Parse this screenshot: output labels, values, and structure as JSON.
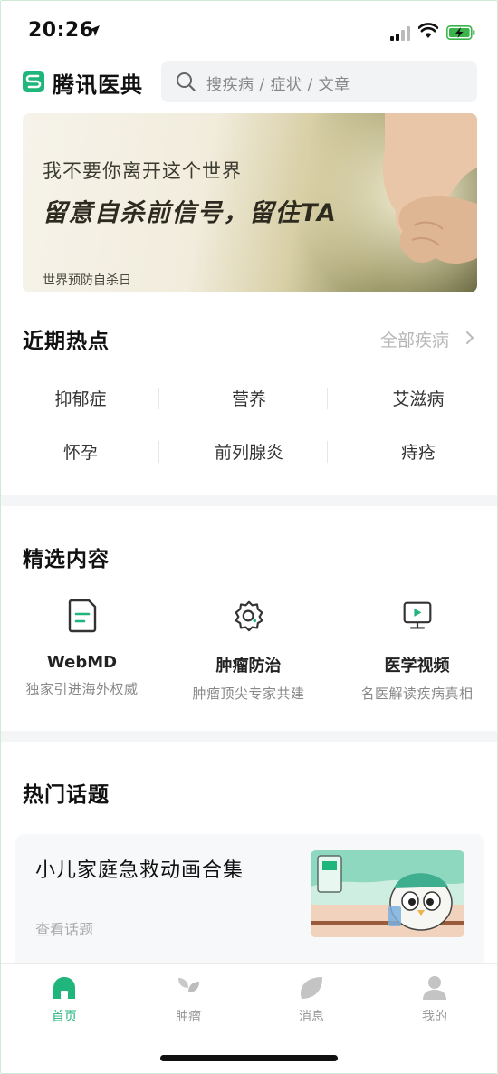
{
  "status_bar": {
    "time": "20:26"
  },
  "header": {
    "app_name": "腾讯医典",
    "search_placeholder": "搜疾病 / 症状 / 文章"
  },
  "banner": {
    "subtitle": "我不要你离开这个世界",
    "headline": "留意自杀前信号，留住TA",
    "footnote": "世界预防自杀日"
  },
  "hot": {
    "title": "近期热点",
    "more_label": "全部疾病",
    "items": [
      "抑郁症",
      "营养",
      "艾滋病",
      "怀孕",
      "前列腺炎",
      "痔疮"
    ]
  },
  "featured": {
    "title": "精选内容",
    "items": [
      {
        "icon": "document-icon",
        "title": "WebMD",
        "desc": "独家引进海外权威"
      },
      {
        "icon": "gear-badge-icon",
        "title": "肿瘤防治",
        "desc": "肿瘤顶尖专家共建"
      },
      {
        "icon": "video-monitor-icon",
        "title": "医学视频",
        "desc": "名医解读疾病真相"
      }
    ]
  },
  "topics": {
    "title": "热门话题",
    "card": {
      "title": "小儿家庭急救动画合集",
      "link": "查看话题"
    }
  },
  "tabbar": {
    "items": [
      {
        "label": "首页",
        "icon": "home-icon",
        "active": true
      },
      {
        "label": "肿瘤",
        "icon": "sprout-icon",
        "active": false
      },
      {
        "label": "消息",
        "icon": "leaf-message-icon",
        "active": false
      },
      {
        "label": "我的",
        "icon": "person-icon",
        "active": false
      }
    ]
  },
  "colors": {
    "accent": "#20b57a",
    "highlight": "#d6f1e3",
    "muted": "#999999"
  }
}
